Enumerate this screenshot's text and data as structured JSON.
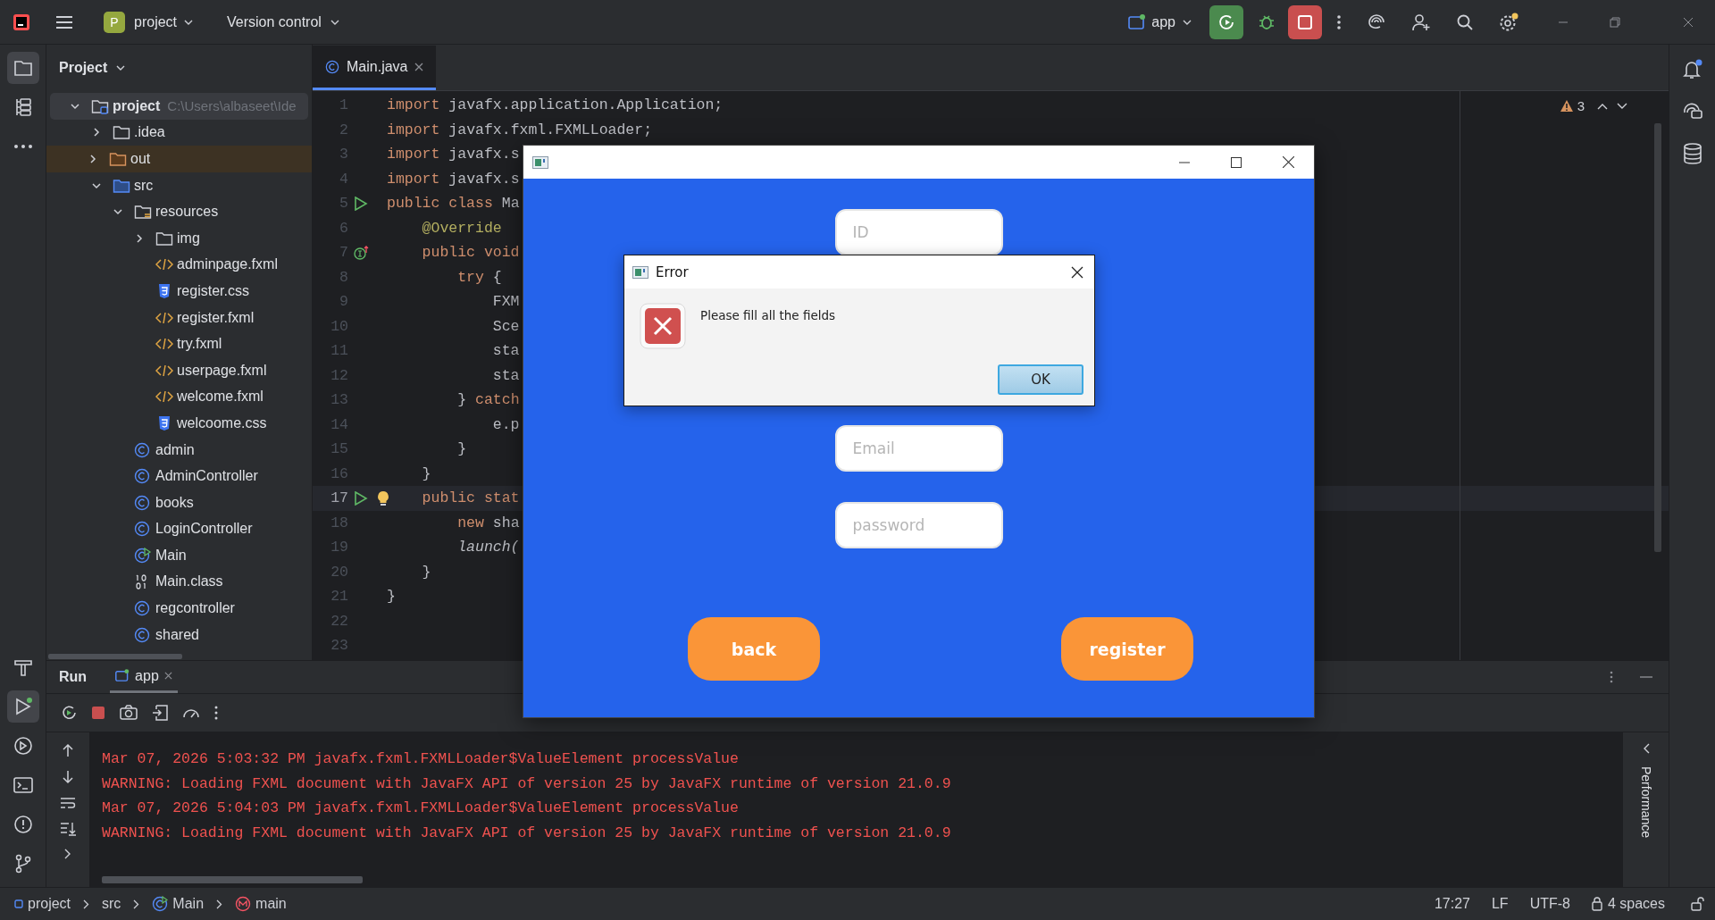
{
  "title_bar": {
    "project_badge": "P",
    "project": "project",
    "vcs": "Version control",
    "run_config": "app"
  },
  "left_toolbar": {
    "top": [
      {
        "kind": "project",
        "selected": true
      },
      {
        "kind": "structure",
        "selected": false
      },
      {
        "kind": "more",
        "selected": false
      }
    ],
    "bottom": [
      {
        "kind": "build",
        "selected": false
      },
      {
        "kind": "run",
        "selected": true
      },
      {
        "kind": "services",
        "selected": false
      },
      {
        "kind": "terminal",
        "selected": false
      },
      {
        "kind": "problems",
        "selected": false
      },
      {
        "kind": "git",
        "selected": false
      }
    ]
  },
  "project_panel": {
    "title": "Project",
    "tree": [
      {
        "name": "project",
        "path": "C:\\Users\\albaseet\\Ide",
        "kind": "project-folder",
        "expanded": true,
        "selected": true,
        "children": [
          {
            "name": ".idea",
            "kind": "folder",
            "expanded": false,
            "selected": false
          },
          {
            "name": "out",
            "kind": "excluded-folder",
            "expanded": false,
            "selected": false
          },
          {
            "name": "src",
            "kind": "source-folder",
            "expanded": true,
            "selected": false,
            "children": [
              {
                "name": "resources",
                "kind": "resources-folder",
                "expanded": true,
                "selected": false,
                "children": [
                  {
                    "name": "img",
                    "kind": "folder",
                    "expanded": false,
                    "selected": false
                  },
                  {
                    "name": "adminpage.fxml",
                    "kind": "fxml",
                    "selected": false
                  },
                  {
                    "name": "register.css",
                    "kind": "css",
                    "selected": false
                  },
                  {
                    "name": "register.fxml",
                    "kind": "fxml",
                    "selected": false
                  },
                  {
                    "name": "try.fxml",
                    "kind": "fxml",
                    "selected": false
                  },
                  {
                    "name": "userpage.fxml",
                    "kind": "fxml",
                    "selected": false
                  },
                  {
                    "name": "welcome.fxml",
                    "kind": "fxml",
                    "selected": false
                  },
                  {
                    "name": "welcoome.css",
                    "kind": "css",
                    "selected": false
                  }
                ]
              },
              {
                "name": "admin",
                "kind": "class",
                "selected": false
              },
              {
                "name": "AdminController",
                "kind": "class",
                "selected": false
              },
              {
                "name": "books",
                "kind": "class",
                "selected": false
              },
              {
                "name": "LoginController",
                "kind": "class",
                "selected": false
              },
              {
                "name": "Main",
                "kind": "main-class",
                "selected": false
              },
              {
                "name": "Main.class",
                "kind": "binary",
                "selected": false
              },
              {
                "name": "regcontroller",
                "kind": "class",
                "selected": false
              },
              {
                "name": "shared",
                "kind": "class",
                "selected": false
              }
            ]
          }
        ]
      }
    ]
  },
  "editor": {
    "tabs": [
      {
        "label": "Main.java",
        "selected": true
      }
    ],
    "warnings": "3",
    "lines": [
      {
        "num": "1",
        "current": false,
        "tokens": [
          {
            "kind": "keyword",
            "text": "import"
          },
          {
            "kind": "plain",
            "text": " javafx.application.Application;"
          }
        ]
      },
      {
        "num": "2",
        "current": false,
        "tokens": [
          {
            "kind": "keyword",
            "text": "import"
          },
          {
            "kind": "plain",
            "text": " javafx.fxml.FXMLLoader;"
          }
        ]
      },
      {
        "num": "3",
        "current": false,
        "tokens": [
          {
            "kind": "keyword",
            "text": "import"
          },
          {
            "kind": "plain",
            "text": " javafx.s"
          }
        ]
      },
      {
        "num": "4",
        "current": false,
        "tokens": [
          {
            "kind": "keyword",
            "text": "import"
          },
          {
            "kind": "plain",
            "text": " javafx.s"
          }
        ]
      },
      {
        "num": "5",
        "current": false,
        "gutter": {
          "kind": "run"
        },
        "tokens": [
          {
            "kind": "keyword",
            "text": "public class"
          },
          {
            "kind": "plain",
            "text": " Ma"
          }
        ]
      },
      {
        "num": "6",
        "current": false,
        "tokens": [
          {
            "kind": "annotation",
            "text": "    @Override"
          }
        ]
      },
      {
        "num": "7",
        "current": false,
        "gutter": {
          "kind": "override"
        },
        "tokens": [
          {
            "kind": "keyword",
            "text": "    public void"
          }
        ]
      },
      {
        "num": "8",
        "current": false,
        "tokens": [
          {
            "kind": "keyword",
            "text": "        try"
          },
          {
            "kind": "plain",
            "text": " {"
          }
        ]
      },
      {
        "num": "9",
        "current": false,
        "tokens": [
          {
            "kind": "plain",
            "text": "            FXM"
          }
        ]
      },
      {
        "num": "10",
        "current": false,
        "tokens": [
          {
            "kind": "plain",
            "text": "            Sce"
          }
        ]
      },
      {
        "num": "11",
        "current": false,
        "tokens": [
          {
            "kind": "plain",
            "text": "            sta"
          }
        ]
      },
      {
        "num": "12",
        "current": false,
        "tokens": [
          {
            "kind": "plain",
            "text": "            sta"
          }
        ]
      },
      {
        "num": "13",
        "current": false,
        "tokens": [
          {
            "kind": "plain",
            "text": "        } "
          },
          {
            "kind": "keyword",
            "text": "catch"
          }
        ]
      },
      {
        "num": "14",
        "current": false,
        "tokens": [
          {
            "kind": "plain",
            "text": "            e.p"
          }
        ]
      },
      {
        "num": "15",
        "current": false,
        "tokens": [
          {
            "kind": "plain",
            "text": "        }"
          }
        ]
      },
      {
        "num": "16",
        "current": false,
        "tokens": [
          {
            "kind": "plain",
            "text": "    }"
          }
        ]
      },
      {
        "num": "17",
        "current": true,
        "gutter": {
          "kind": "run"
        },
        "bulb": true,
        "tokens": [
          {
            "kind": "keyword",
            "text": "    public stat"
          }
        ]
      },
      {
        "num": "18",
        "current": false,
        "tokens": [
          {
            "kind": "keyword",
            "text": "        new"
          },
          {
            "kind": "plain",
            "text": " sha"
          }
        ]
      },
      {
        "num": "19",
        "current": false,
        "tokens": [
          {
            "kind": "static-call",
            "text": "        launch("
          }
        ]
      },
      {
        "num": "20",
        "current": false,
        "tokens": [
          {
            "kind": "plain",
            "text": "    }"
          }
        ]
      },
      {
        "num": "21",
        "current": false,
        "tokens": [
          {
            "kind": "plain",
            "text": "}"
          }
        ]
      },
      {
        "num": "22",
        "current": false
      },
      {
        "num": "23",
        "current": false
      }
    ]
  },
  "app_window": {
    "fields": [
      {
        "placeholder": "ID"
      },
      {
        "placeholder": "Email"
      },
      {
        "placeholder": "password"
      }
    ],
    "buttons": [
      "back",
      "register"
    ]
  },
  "dialog": {
    "title": "Error",
    "message": "Please fill all the fields",
    "button": "OK"
  },
  "run_panel": {
    "title": "Run",
    "tabs": [
      {
        "label": "app",
        "selected": true
      }
    ],
    "side_label": "Performance",
    "console": [
      "Mar 07, 2026 5:03:32 PM javafx.fxml.FXMLLoader$ValueElement processValue",
      "WARNING: Loading FXML document with JavaFX API of version 25 by JavaFX runtime of version 21.0.9",
      "Mar 07, 2026 5:04:03 PM javafx.fxml.FXMLLoader$ValueElement processValue",
      "WARNING: Loading FXML document with JavaFX API of version 25 by JavaFX runtime of version 21.0.9"
    ]
  },
  "status_bar": {
    "breadcrumbs": [
      {
        "label": "project",
        "kind": "module"
      },
      {
        "label": "src",
        "kind": "folder"
      },
      {
        "label": "Main",
        "kind": "class"
      },
      {
        "label": "main",
        "kind": "method"
      }
    ],
    "position": "17:27",
    "line_ending": "LF",
    "encoding": "UTF-8",
    "indent": "4 spaces"
  }
}
